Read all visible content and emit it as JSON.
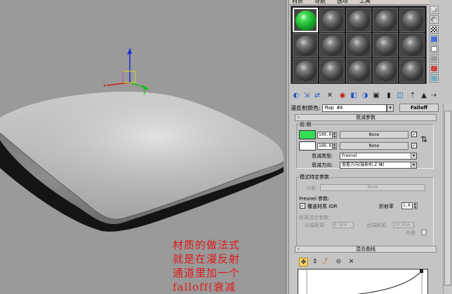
{
  "menubar": {
    "items": [
      "材质",
      "导航",
      "选项",
      "工具"
    ]
  },
  "slots": {
    "active_index": 0,
    "count": 15,
    "active_color": "#22c43a"
  },
  "toolbar": {
    "icons": [
      "get-material-icon",
      "put-to-scene-icon",
      "assign-icon",
      "reset-icon",
      "make-unique-icon",
      "put-to-library-icon",
      "material-id-icon",
      "show-map-icon",
      "show-end-result-icon",
      "go-to-parent-icon",
      "go-forward-icon"
    ]
  },
  "map_row": {
    "label": "漫反射颜色:",
    "map_name": "Map #4",
    "type_button": "Falloff"
  },
  "falloff_params": {
    "title": "衰减参数",
    "front_side_label": "前:侧",
    "color1": {
      "swatch": "#33dd55",
      "amount": "100.0",
      "map": "None",
      "checked": "✓"
    },
    "color2": {
      "swatch": "#ffffff",
      "amount": "100.0",
      "map": "None",
      "checked": "✓"
    },
    "falloff_type_label": "衰减类型:",
    "falloff_type_value": "Fresnel",
    "falloff_direction_label": "衰减方向:",
    "falloff_direction_value": "查看方向(摄影机 Z 轴)"
  },
  "mode_params": {
    "title": "模式特定参数",
    "object_label": "对象:",
    "object_value": "None",
    "fresnel_label": "Fresnel 参数:",
    "override_ior_label": "覆盖材质 IOR",
    "override_ior_checked": "✓",
    "ior_label": "折射率",
    "ior_value": "1.6",
    "distance_label": "距离混合参数:",
    "near_label": "近端距离:",
    "near_value": "0.0cm",
    "far_label": "远端距离:",
    "far_value": "10.0cm",
    "extrapolate_label": "外推"
  },
  "mix_curve": {
    "title": "混合曲线"
  },
  "annotation": {
    "lines": [
      "材质的做法式",
      "就是在漫反射",
      "通道里加一个",
      "falloff(衰减"
    ]
  }
}
